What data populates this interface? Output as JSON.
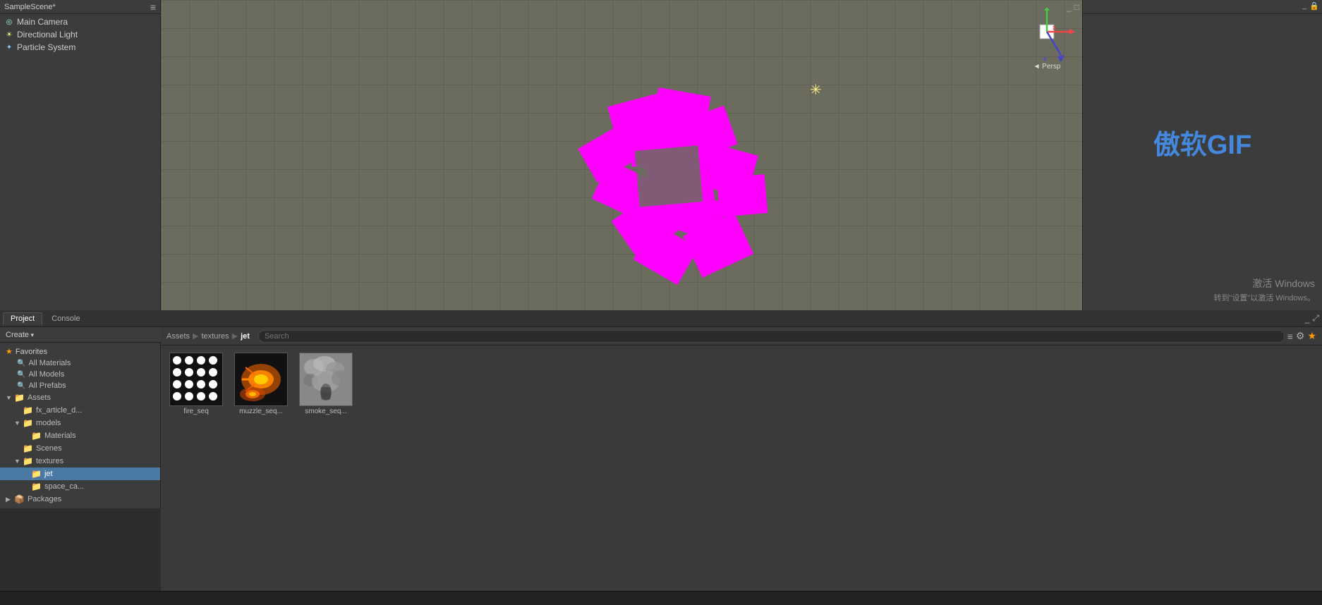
{
  "app": {
    "title": "SampleScene*"
  },
  "hierarchy": {
    "header": "SampleScene*",
    "items": [
      {
        "id": "main-camera",
        "label": "Main Camera",
        "icon": "camera"
      },
      {
        "id": "directional-light",
        "label": "Directional Light",
        "icon": "light"
      },
      {
        "id": "particle-system",
        "label": "Particle System",
        "icon": "particle"
      }
    ]
  },
  "scene": {
    "persp_label": "◄ Persp",
    "axis_x": "x",
    "axis_z": "z"
  },
  "tabs": {
    "project_label": "Project",
    "console_label": "Console"
  },
  "project": {
    "create_label": "Create",
    "favorites_label": "Favorites",
    "all_materials_label": "All Materials",
    "all_models_label": "All Models",
    "all_prefabs_label": "All Prefabs",
    "assets_label": "Assets",
    "fx_article_label": "fx_article_d...",
    "models_label": "models",
    "materials_label": "Materials",
    "scenes_label": "Scenes",
    "textures_label": "textures",
    "jet_label": "jet",
    "space_ca_label": "space_ca...",
    "packages_label": "Packages"
  },
  "breadcrumb": {
    "assets": "Assets",
    "textures": "textures",
    "jet": "jet"
  },
  "assets": [
    {
      "id": "fire-seq",
      "label": "fire_seq"
    },
    {
      "id": "muzzle-seq",
      "label": "muzzle_seq..."
    },
    {
      "id": "smoke-seq",
      "label": "smoke_seq..."
    }
  ],
  "watermark": {
    "brand": "傲软GIF",
    "activate": "激活 Windows",
    "activate_sub": "转到\"设置\"以激活 Windows。"
  },
  "status": {
    "text": ""
  }
}
